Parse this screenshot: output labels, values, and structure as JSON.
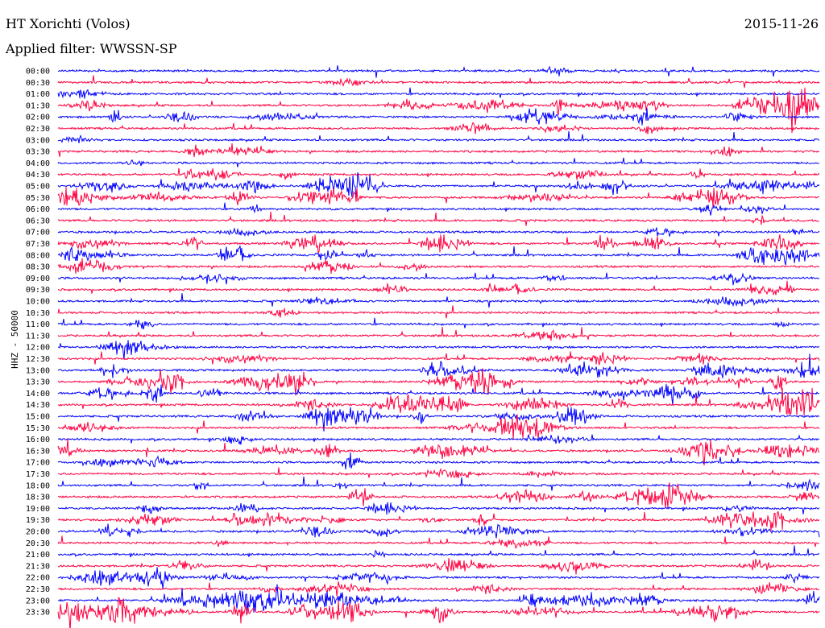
{
  "header": {
    "station": "HT Xorichti (Volos)",
    "date": "2015-11-26",
    "filter": "Applied filter: WWSSN-SP"
  },
  "chart_data": {
    "type": "line",
    "title": "HT Xorichti (Volos)",
    "subtitle": "Applied filter: WWSSN-SP",
    "ylabel": "HHZ - 50000",
    "colors": [
      "#0000ff",
      "#ff0040"
    ],
    "rows": [
      "00:00",
      "00:30",
      "01:00",
      "01:30",
      "02:00",
      "02:30",
      "03:00",
      "03:30",
      "04:00",
      "04:30",
      "05:00",
      "05:30",
      "06:00",
      "06:30",
      "07:00",
      "07:30",
      "08:00",
      "08:30",
      "09:00",
      "09:30",
      "10:00",
      "10:30",
      "11:00",
      "11:30",
      "12:00",
      "12:30",
      "13:00",
      "13:30",
      "14:00",
      "14:30",
      "15:00",
      "15:30",
      "16:00",
      "16:30",
      "17:00",
      "17:30",
      "18:00",
      "18:30",
      "19:00",
      "19:30",
      "20:00",
      "20:30",
      "21:00",
      "21:30",
      "22:00",
      "22:30",
      "23:00",
      "23:30"
    ],
    "activity": [
      0.05,
      0.1,
      0.1,
      0.8,
      0.5,
      0.2,
      0.1,
      0.2,
      0.1,
      0.4,
      0.9,
      0.6,
      0.2,
      0.1,
      0.2,
      0.6,
      0.6,
      0.3,
      0.2,
      0.3,
      0.15,
      0.1,
      0.15,
      0.1,
      0.15,
      0.3,
      0.5,
      0.8,
      0.6,
      0.7,
      0.6,
      0.4,
      0.15,
      0.6,
      0.3,
      0.15,
      0.2,
      0.6,
      0.3,
      0.6,
      0.4,
      0.15,
      0.1,
      0.4,
      0.4,
      0.3,
      0.7,
      0.8
    ]
  }
}
